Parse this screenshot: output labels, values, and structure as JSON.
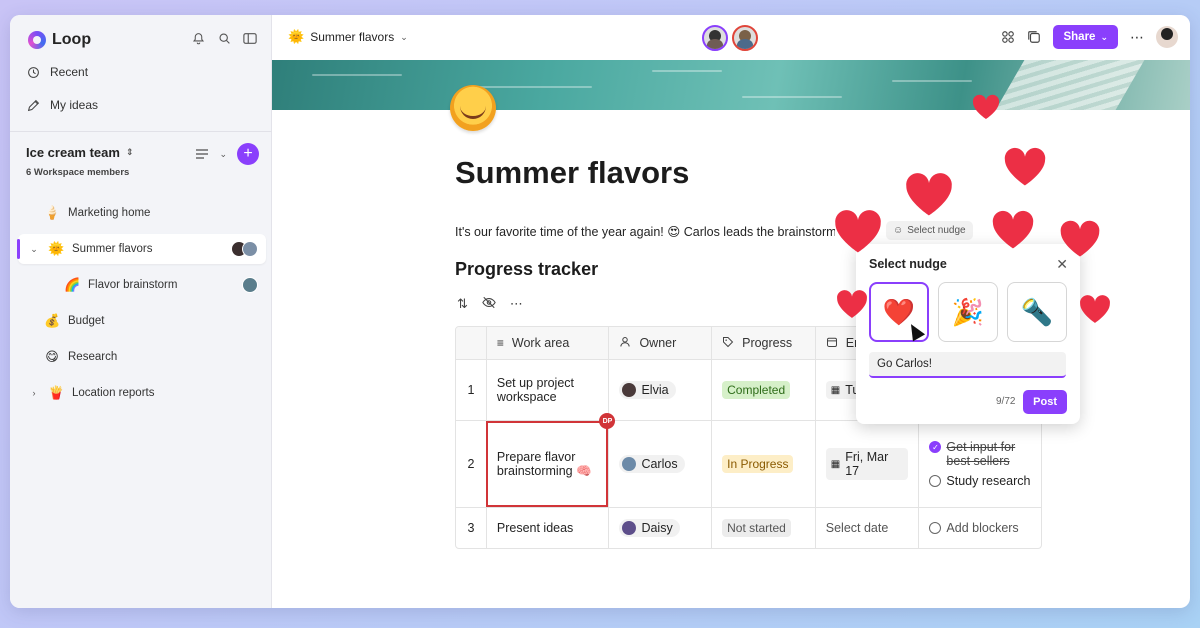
{
  "app": {
    "name": "Loop"
  },
  "sidebar": {
    "nav": [
      {
        "label": "Recent",
        "icon": "clock-icon"
      },
      {
        "label": "My ideas",
        "icon": "pencil-icon"
      }
    ],
    "workspace": {
      "name": "Ice cream team",
      "members": "6 Workspace members"
    },
    "pages": [
      {
        "label": "Marketing home",
        "emoji": "🍦"
      },
      {
        "label": "Summer flavors",
        "emoji": "🌞"
      },
      {
        "label": "Flavor brainstorm",
        "emoji": "🌈"
      },
      {
        "label": "Budget",
        "emoji": "💰"
      },
      {
        "label": "Research",
        "emoji": "😋"
      },
      {
        "label": "Location reports",
        "emoji": "🍟"
      }
    ]
  },
  "topbar": {
    "title": "Summer flavors",
    "share_label": "Share"
  },
  "page": {
    "title": "Summer flavors",
    "intro": "It's our favorite time of the year again! 😍 Carlos leads the brainstorm",
    "nudge_chip": "Select nudge",
    "section_title": "Progress tracker"
  },
  "table": {
    "headers": [
      "Work area",
      "Owner",
      "Progress",
      "End date"
    ],
    "rows": [
      {
        "n": "1",
        "work": "Set up project workspace",
        "owner": "Elvia",
        "progress": "Completed",
        "date": "Tue"
      },
      {
        "n": "2",
        "work": "Prepare flavor brainstorming 🧠",
        "owner": "Carlos",
        "progress": "In Progress",
        "date": "Fri, Mar 17",
        "todo1": "Get input for best sellers",
        "todo2": "Study research"
      },
      {
        "n": "3",
        "work": "Present ideas",
        "owner": "Daisy",
        "progress": "Not started",
        "date": "Select date",
        "todo1": "Add blockers"
      }
    ],
    "badge": "DP"
  },
  "popup": {
    "title": "Select nudge",
    "options": [
      "❤️",
      "🎉",
      "🔦"
    ],
    "message": "Go Carlos!",
    "count": "9/72",
    "post_label": "Post"
  },
  "colors": {
    "accent": "#8a3ffc",
    "heart": "#ec2f45"
  }
}
